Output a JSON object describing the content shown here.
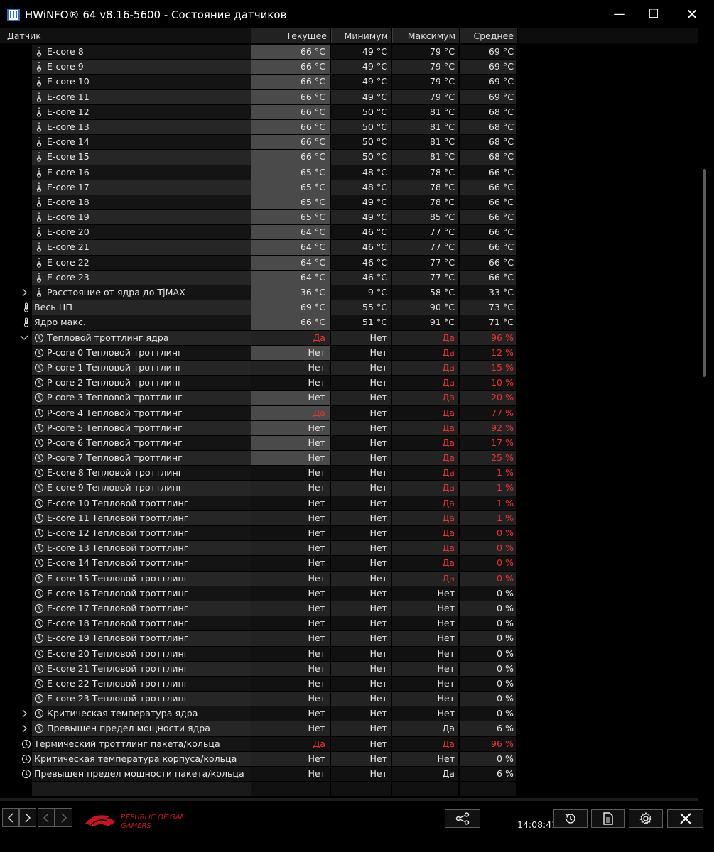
{
  "window": {
    "title": "HWiNFO® 64 v8.16-5600 - Состояние датчиков"
  },
  "columns": {
    "sensor": "Датчик",
    "current": "Текущее",
    "min": "Минимум",
    "max": "Максимум",
    "avg": "Среднее"
  },
  "colors": {
    "warning": "#ee3030",
    "background": "#000000",
    "highlight": "#4a4a4a"
  },
  "rows": [
    {
      "label": "E-core 8",
      "icon": "thermometer-icon",
      "level": 2,
      "cur": "66 °C",
      "min": "49 °C",
      "max": "79 °C",
      "avg": "69 °C",
      "hl": true
    },
    {
      "label": "E-core 9",
      "icon": "thermometer-icon",
      "level": 2,
      "cur": "66 °C",
      "min": "49 °C",
      "max": "79 °C",
      "avg": "69 °C",
      "hl": true
    },
    {
      "label": "E-core 10",
      "icon": "thermometer-icon",
      "level": 2,
      "cur": "66 °C",
      "min": "49 °C",
      "max": "79 °C",
      "avg": "69 °C",
      "hl": true
    },
    {
      "label": "E-core 11",
      "icon": "thermometer-icon",
      "level": 2,
      "cur": "66 °C",
      "min": "49 °C",
      "max": "79 °C",
      "avg": "69 °C",
      "hl": true
    },
    {
      "label": "E-core 12",
      "icon": "thermometer-icon",
      "level": 2,
      "cur": "66 °C",
      "min": "50 °C",
      "max": "81 °C",
      "avg": "68 °C",
      "hl": true
    },
    {
      "label": "E-core 13",
      "icon": "thermometer-icon",
      "level": 2,
      "cur": "66 °C",
      "min": "50 °C",
      "max": "81 °C",
      "avg": "68 °C",
      "hl": true
    },
    {
      "label": "E-core 14",
      "icon": "thermometer-icon",
      "level": 2,
      "cur": "66 °C",
      "min": "50 °C",
      "max": "81 °C",
      "avg": "68 °C",
      "hl": true
    },
    {
      "label": "E-core 15",
      "icon": "thermometer-icon",
      "level": 2,
      "cur": "66 °C",
      "min": "50 °C",
      "max": "81 °C",
      "avg": "68 °C",
      "hl": true
    },
    {
      "label": "E-core 16",
      "icon": "thermometer-icon",
      "level": 2,
      "cur": "65 °C",
      "min": "48 °C",
      "max": "78 °C",
      "avg": "66 °C",
      "hl": true
    },
    {
      "label": "E-core 17",
      "icon": "thermometer-icon",
      "level": 2,
      "cur": "65 °C",
      "min": "48 °C",
      "max": "78 °C",
      "avg": "66 °C",
      "hl": true
    },
    {
      "label": "E-core 18",
      "icon": "thermometer-icon",
      "level": 2,
      "cur": "65 °C",
      "min": "49 °C",
      "max": "78 °C",
      "avg": "66 °C",
      "hl": true
    },
    {
      "label": "E-core 19",
      "icon": "thermometer-icon",
      "level": 2,
      "cur": "65 °C",
      "min": "49 °C",
      "max": "85 °C",
      "avg": "66 °C",
      "hl": true
    },
    {
      "label": "E-core 20",
      "icon": "thermometer-icon",
      "level": 2,
      "cur": "64 °C",
      "min": "46 °C",
      "max": "77 °C",
      "avg": "66 °C",
      "hl": true
    },
    {
      "label": "E-core 21",
      "icon": "thermometer-icon",
      "level": 2,
      "cur": "64 °C",
      "min": "46 °C",
      "max": "77 °C",
      "avg": "66 °C",
      "hl": true
    },
    {
      "label": "E-core 22",
      "icon": "thermometer-icon",
      "level": 2,
      "cur": "64 °C",
      "min": "46 °C",
      "max": "77 °C",
      "avg": "66 °C",
      "hl": true
    },
    {
      "label": "E-core 23",
      "icon": "thermometer-icon",
      "level": 2,
      "cur": "64 °C",
      "min": "46 °C",
      "max": "77 °C",
      "avg": "66 °C",
      "hl": true
    },
    {
      "label": "Расстояние от ядра до TjMAX",
      "icon": "thermometer-icon",
      "level": 2,
      "expander": "collapsed",
      "cur": "36 °C",
      "min": "9 °C",
      "max": "58 °C",
      "avg": "33 °C",
      "hl": true
    },
    {
      "label": "Весь ЦП",
      "icon": "thermometer-icon",
      "level": 1,
      "cur": "69 °C",
      "min": "55 °C",
      "max": "90 °C",
      "avg": "73 °C",
      "hl": true
    },
    {
      "label": "Ядро макс.",
      "icon": "thermometer-icon",
      "level": 1,
      "cur": "66 °C",
      "min": "51 °C",
      "max": "91 °C",
      "avg": "71 °C",
      "hl": true
    },
    {
      "label": "Тепловой троттлинг ядра",
      "icon": "clock-icon",
      "level": 2,
      "expander": "expanded",
      "cur": "Да",
      "min": "Нет",
      "max": "Да",
      "avg": "96 %",
      "red": [
        "cur",
        "max",
        "avg"
      ]
    },
    {
      "label": "P-core 0 Тепловой троттлинг",
      "icon": "clock-icon",
      "level": 2,
      "cur": "Нет",
      "min": "Нет",
      "max": "Да",
      "avg": "12 %",
      "red": [
        "max",
        "avg"
      ],
      "hl": true
    },
    {
      "label": "P-core 1 Тепловой троттлинг",
      "icon": "clock-icon",
      "level": 2,
      "cur": "Нет",
      "min": "Нет",
      "max": "Да",
      "avg": "15 %",
      "red": [
        "max",
        "avg"
      ]
    },
    {
      "label": "P-core 2 Тепловой троттлинг",
      "icon": "clock-icon",
      "level": 2,
      "cur": "Нет",
      "min": "Нет",
      "max": "Да",
      "avg": "10 %",
      "red": [
        "max",
        "avg"
      ]
    },
    {
      "label": "P-core 3 Тепловой троттлинг",
      "icon": "clock-icon",
      "level": 2,
      "cur": "Нет",
      "min": "Нет",
      "max": "Да",
      "avg": "20 %",
      "red": [
        "max",
        "avg"
      ],
      "hl": true
    },
    {
      "label": "P-core 4 Тепловой троттлинг",
      "icon": "clock-icon",
      "level": 2,
      "cur": "Да",
      "min": "Нет",
      "max": "Да",
      "avg": "77 %",
      "red": [
        "cur",
        "max",
        "avg"
      ],
      "hl": true
    },
    {
      "label": "P-core 5 Тепловой троттлинг",
      "icon": "clock-icon",
      "level": 2,
      "cur": "Нет",
      "min": "Нет",
      "max": "Да",
      "avg": "92 %",
      "red": [
        "max",
        "avg"
      ],
      "hl": true
    },
    {
      "label": "P-core 6 Тепловой троттлинг",
      "icon": "clock-icon",
      "level": 2,
      "cur": "Нет",
      "min": "Нет",
      "max": "Да",
      "avg": "17 %",
      "red": [
        "max",
        "avg"
      ],
      "hl": true
    },
    {
      "label": "P-core 7 Тепловой троттлинг",
      "icon": "clock-icon",
      "level": 2,
      "cur": "Нет",
      "min": "Нет",
      "max": "Да",
      "avg": "25 %",
      "red": [
        "max",
        "avg"
      ],
      "hl": true
    },
    {
      "label": "E-core 8 Тепловой троттлинг",
      "icon": "clock-icon",
      "level": 2,
      "cur": "Нет",
      "min": "Нет",
      "max": "Да",
      "avg": "1 %",
      "red": [
        "max",
        "avg"
      ]
    },
    {
      "label": "E-core 9 Тепловой троттлинг",
      "icon": "clock-icon",
      "level": 2,
      "cur": "Нет",
      "min": "Нет",
      "max": "Да",
      "avg": "1 %",
      "red": [
        "max",
        "avg"
      ]
    },
    {
      "label": "E-core 10 Тепловой троттлинг",
      "icon": "clock-icon",
      "level": 2,
      "cur": "Нет",
      "min": "Нет",
      "max": "Да",
      "avg": "1 %",
      "red": [
        "max",
        "avg"
      ]
    },
    {
      "label": "E-core 11 Тепловой троттлинг",
      "icon": "clock-icon",
      "level": 2,
      "cur": "Нет",
      "min": "Нет",
      "max": "Да",
      "avg": "1 %",
      "red": [
        "max",
        "avg"
      ]
    },
    {
      "label": "E-core 12 Тепловой троттлинг",
      "icon": "clock-icon",
      "level": 2,
      "cur": "Нет",
      "min": "Нет",
      "max": "Да",
      "avg": "0 %",
      "red": [
        "max",
        "avg"
      ]
    },
    {
      "label": "E-core 13 Тепловой троттлинг",
      "icon": "clock-icon",
      "level": 2,
      "cur": "Нет",
      "min": "Нет",
      "max": "Да",
      "avg": "0 %",
      "red": [
        "max",
        "avg"
      ]
    },
    {
      "label": "E-core 14 Тепловой троттлинг",
      "icon": "clock-icon",
      "level": 2,
      "cur": "Нет",
      "min": "Нет",
      "max": "Да",
      "avg": "0 %",
      "red": [
        "max",
        "avg"
      ]
    },
    {
      "label": "E-core 15 Тепловой троттлинг",
      "icon": "clock-icon",
      "level": 2,
      "cur": "Нет",
      "min": "Нет",
      "max": "Да",
      "avg": "0 %",
      "red": [
        "max",
        "avg"
      ]
    },
    {
      "label": "E-core 16 Тепловой троттлинг",
      "icon": "clock-icon",
      "level": 2,
      "cur": "Нет",
      "min": "Нет",
      "max": "Нет",
      "avg": "0 %"
    },
    {
      "label": "E-core 17 Тепловой троттлинг",
      "icon": "clock-icon",
      "level": 2,
      "cur": "Нет",
      "min": "Нет",
      "max": "Нет",
      "avg": "0 %"
    },
    {
      "label": "E-core 18 Тепловой троттлинг",
      "icon": "clock-icon",
      "level": 2,
      "cur": "Нет",
      "min": "Нет",
      "max": "Нет",
      "avg": "0 %"
    },
    {
      "label": "E-core 19 Тепловой троттлинг",
      "icon": "clock-icon",
      "level": 2,
      "cur": "Нет",
      "min": "Нет",
      "max": "Нет",
      "avg": "0 %"
    },
    {
      "label": "E-core 20 Тепловой троттлинг",
      "icon": "clock-icon",
      "level": 2,
      "cur": "Нет",
      "min": "Нет",
      "max": "Нет",
      "avg": "0 %"
    },
    {
      "label": "E-core 21 Тепловой троттлинг",
      "icon": "clock-icon",
      "level": 2,
      "cur": "Нет",
      "min": "Нет",
      "max": "Нет",
      "avg": "0 %"
    },
    {
      "label": "E-core 22 Тепловой троттлинг",
      "icon": "clock-icon",
      "level": 2,
      "cur": "Нет",
      "min": "Нет",
      "max": "Нет",
      "avg": "0 %"
    },
    {
      "label": "E-core 23 Тепловой троттлинг",
      "icon": "clock-icon",
      "level": 2,
      "cur": "Нет",
      "min": "Нет",
      "max": "Нет",
      "avg": "0 %"
    },
    {
      "label": "Критическая температура ядра",
      "icon": "clock-icon",
      "level": 2,
      "expander": "collapsed",
      "cur": "Нет",
      "min": "Нет",
      "max": "Нет",
      "avg": "0 %"
    },
    {
      "label": "Превышен предел мощности ядра",
      "icon": "clock-icon",
      "level": 2,
      "expander": "collapsed",
      "cur": "Нет",
      "min": "Нет",
      "max": "Да",
      "avg": "6 %"
    },
    {
      "label": "Термический троттлинг пакета/кольца",
      "icon": "clock-icon",
      "level": 1,
      "cur": "Да",
      "min": "Нет",
      "max": "Да",
      "avg": "96 %",
      "red": [
        "cur",
        "max",
        "avg"
      ]
    },
    {
      "label": "Критическая температура корпуса/кольца",
      "icon": "clock-icon",
      "level": 1,
      "cur": "Нет",
      "min": "Нет",
      "max": "Нет",
      "avg": "0 %"
    },
    {
      "label": "Превышен предел мощности пакета/кольца",
      "icon": "clock-icon",
      "level": 1,
      "cur": "Нет",
      "min": "Нет",
      "max": "Да",
      "avg": "6 %"
    }
  ],
  "footer": {
    "time": "14:08:41",
    "brand": "REPUBLIC OF GAMERS"
  }
}
